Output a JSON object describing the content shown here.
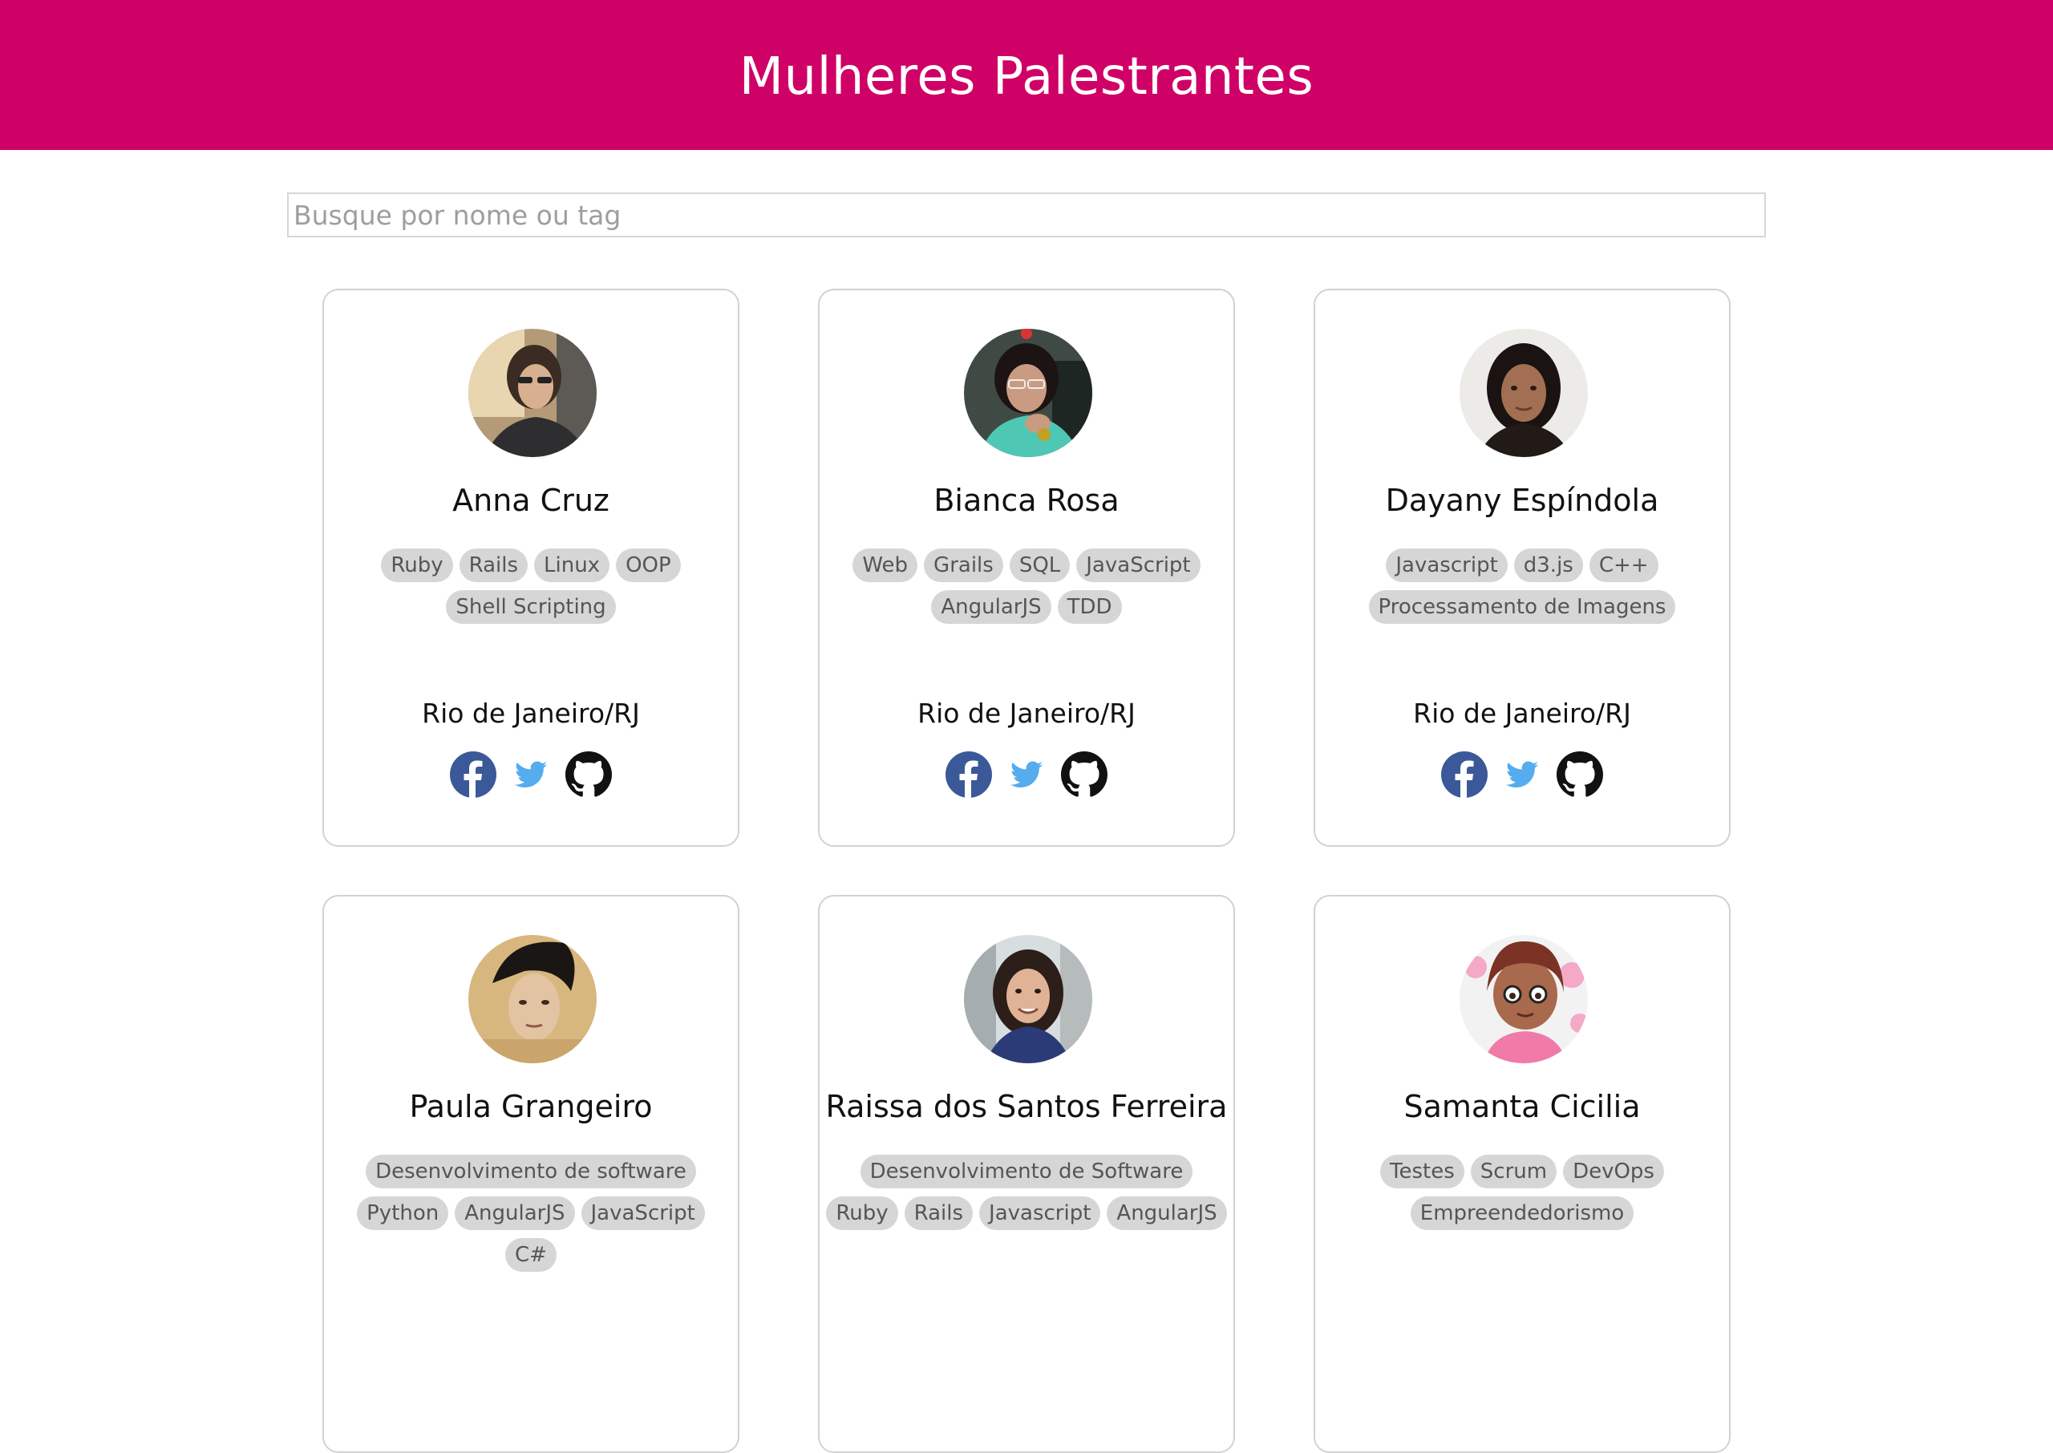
{
  "header": {
    "title": "Mulheres Palestrantes"
  },
  "search": {
    "placeholder": "Busque por nome ou tag",
    "value": ""
  },
  "speakers": [
    {
      "name": "Anna Cruz",
      "tags": [
        "Ruby",
        "Rails",
        "Linux",
        "OOP",
        "Shell Scripting"
      ],
      "location": "Rio de Janeiro/RJ",
      "socials": [
        "facebook-icon",
        "twitter-icon",
        "github-icon"
      ]
    },
    {
      "name": "Bianca Rosa",
      "tags": [
        "Web",
        "Grails",
        "SQL",
        "JavaScript",
        "AngularJS",
        "TDD"
      ],
      "location": "Rio de Janeiro/RJ",
      "socials": [
        "facebook-icon",
        "twitter-icon",
        "github-icon"
      ]
    },
    {
      "name": "Dayany Espíndola",
      "tags": [
        "Javascript",
        "d3.js",
        "C++",
        "Processamento de Imagens"
      ],
      "location": "Rio de Janeiro/RJ",
      "socials": [
        "facebook-icon",
        "twitter-icon",
        "github-icon"
      ]
    },
    {
      "name": "Paula Grangeiro",
      "tags": [
        "Desenvolvimento de software",
        "Python",
        "AngularJS",
        "JavaScript",
        "C#"
      ],
      "location": "",
      "socials": []
    },
    {
      "name": "Raissa dos Santos Ferreira",
      "tags": [
        "Desenvolvimento de Software",
        "Ruby",
        "Rails",
        "Javascript",
        "AngularJS"
      ],
      "location": "",
      "socials": []
    },
    {
      "name": "Samanta Cicilia",
      "tags": [
        "Testes",
        "Scrum",
        "DevOps",
        "Empreendedorismo"
      ],
      "location": "",
      "socials": []
    }
  ],
  "colors": {
    "header_bg": "#cf0066",
    "tag_bg": "#d6d6d6",
    "facebook": "#3b5998",
    "twitter": "#55acee",
    "github": "#111111"
  }
}
